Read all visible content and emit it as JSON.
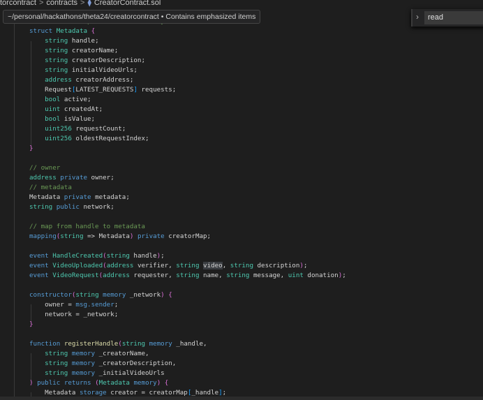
{
  "breadcrumb": {
    "items": [
      "torcontract",
      "contracts",
      "CreatorContract.sol"
    ]
  },
  "tooltip": {
    "text": "~/personal/hackathons/theta24/creatorcontract • Contains emphasized items"
  },
  "find": {
    "value": "read"
  },
  "code": [
    [
      [
        "cm",
        "// struct to represent a data entry"
      ]
    ],
    [
      [
        "kw",
        "struct"
      ],
      [
        "pl",
        " "
      ],
      [
        "ty",
        "Metadata"
      ],
      [
        "pl",
        " "
      ],
      [
        "br",
        "{"
      ]
    ],
    [
      [
        "pl",
        "    "
      ],
      [
        "ty",
        "string"
      ],
      [
        "id",
        " handle;"
      ]
    ],
    [
      [
        "pl",
        "    "
      ],
      [
        "ty",
        "string"
      ],
      [
        "id",
        " creatorName;"
      ]
    ],
    [
      [
        "pl",
        "    "
      ],
      [
        "ty",
        "string"
      ],
      [
        "id",
        " creatorDescription;"
      ]
    ],
    [
      [
        "pl",
        "    "
      ],
      [
        "ty",
        "string"
      ],
      [
        "id",
        " initialVideoUrls;"
      ]
    ],
    [
      [
        "pl",
        "    "
      ],
      [
        "ty",
        "address"
      ],
      [
        "id",
        " creatorAddress;"
      ]
    ],
    [
      [
        "pl",
        "    "
      ],
      [
        "id",
        "Request"
      ],
      [
        "br2",
        "["
      ],
      [
        "id",
        "LATEST_REQUESTS"
      ],
      [
        "br2",
        "]"
      ],
      [
        "id",
        " requests;"
      ]
    ],
    [
      [
        "pl",
        "    "
      ],
      [
        "ty",
        "bool"
      ],
      [
        "id",
        " active;"
      ]
    ],
    [
      [
        "pl",
        "    "
      ],
      [
        "ty",
        "uint"
      ],
      [
        "id",
        " createdAt;"
      ]
    ],
    [
      [
        "pl",
        "    "
      ],
      [
        "ty",
        "bool"
      ],
      [
        "id",
        " isValue;"
      ]
    ],
    [
      [
        "pl",
        "    "
      ],
      [
        "ty",
        "uint256"
      ],
      [
        "id",
        " requestCount;"
      ]
    ],
    [
      [
        "pl",
        "    "
      ],
      [
        "ty",
        "uint256"
      ],
      [
        "id",
        " oldestRequestIndex;"
      ]
    ],
    [
      [
        "br",
        "}"
      ]
    ],
    [],
    [
      [
        "cm",
        "// owner"
      ]
    ],
    [
      [
        "ty",
        "address"
      ],
      [
        "pl",
        " "
      ],
      [
        "kw",
        "private"
      ],
      [
        "id",
        " owner;"
      ]
    ],
    [
      [
        "cm",
        "// metadata"
      ]
    ],
    [
      [
        "id",
        "Metadata "
      ],
      [
        "kw",
        "private"
      ],
      [
        "id",
        " metadata;"
      ]
    ],
    [
      [
        "ty",
        "string"
      ],
      [
        "pl",
        " "
      ],
      [
        "kw",
        "public"
      ],
      [
        "id",
        " network;"
      ]
    ],
    [],
    [
      [
        "cm",
        "// map from handle to metadata"
      ]
    ],
    [
      [
        "kw",
        "mapping"
      ],
      [
        "br",
        "("
      ],
      [
        "ty",
        "string"
      ],
      [
        "id",
        " => Metadata"
      ],
      [
        "br",
        ")"
      ],
      [
        "pl",
        " "
      ],
      [
        "kw",
        "private"
      ],
      [
        "id",
        " creatorMap;"
      ]
    ],
    [],
    [
      [
        "kw",
        "event"
      ],
      [
        "pl",
        " "
      ],
      [
        "ty",
        "HandleCreated"
      ],
      [
        "br",
        "("
      ],
      [
        "ty",
        "string"
      ],
      [
        "id",
        " handle"
      ],
      [
        "br",
        ")"
      ],
      [
        "id",
        ";"
      ]
    ],
    [
      [
        "kw",
        "event"
      ],
      [
        "pl",
        " "
      ],
      [
        "ty",
        "VideoUploaded"
      ],
      [
        "br",
        "("
      ],
      [
        "ty",
        "address"
      ],
      [
        "id",
        " verifier, "
      ],
      [
        "ty",
        "string"
      ],
      [
        "pl",
        " "
      ],
      [
        "hl",
        "video"
      ],
      [
        "id",
        ", "
      ],
      [
        "ty",
        "string"
      ],
      [
        "id",
        " description"
      ],
      [
        "br",
        ")"
      ],
      [
        "id",
        ";"
      ]
    ],
    [
      [
        "kw",
        "event"
      ],
      [
        "pl",
        " "
      ],
      [
        "ty",
        "VideoRequest"
      ],
      [
        "br",
        "("
      ],
      [
        "ty",
        "address"
      ],
      [
        "id",
        " requester, "
      ],
      [
        "ty",
        "string"
      ],
      [
        "id",
        " name, "
      ],
      [
        "ty",
        "string"
      ],
      [
        "id",
        " message, "
      ],
      [
        "ty",
        "uint"
      ],
      [
        "id",
        " donation"
      ],
      [
        "br",
        ")"
      ],
      [
        "id",
        ";"
      ]
    ],
    [],
    [
      [
        "kw",
        "constructor"
      ],
      [
        "br",
        "("
      ],
      [
        "ty",
        "string"
      ],
      [
        "pl",
        " "
      ],
      [
        "kw",
        "memory"
      ],
      [
        "id",
        " _network"
      ],
      [
        "br",
        ")"
      ],
      [
        "pl",
        " "
      ],
      [
        "br",
        "{"
      ]
    ],
    [
      [
        "pl",
        "    "
      ],
      [
        "id",
        "owner = "
      ],
      [
        "kw",
        "msg.sender"
      ],
      [
        "id",
        ";"
      ]
    ],
    [
      [
        "pl",
        "    "
      ],
      [
        "id",
        "network = _network;"
      ]
    ],
    [
      [
        "br",
        "}"
      ]
    ],
    [],
    [
      [
        "kw",
        "function"
      ],
      [
        "pl",
        " "
      ],
      [
        "fn",
        "registerHandle"
      ],
      [
        "br",
        "("
      ],
      [
        "ty",
        "string"
      ],
      [
        "pl",
        " "
      ],
      [
        "kw",
        "memory"
      ],
      [
        "id",
        " _handle,"
      ]
    ],
    [
      [
        "pl",
        "    "
      ],
      [
        "ty",
        "string"
      ],
      [
        "pl",
        " "
      ],
      [
        "kw",
        "memory"
      ],
      [
        "id",
        " _creatorName,"
      ]
    ],
    [
      [
        "pl",
        "    "
      ],
      [
        "ty",
        "string"
      ],
      [
        "pl",
        " "
      ],
      [
        "kw",
        "memory"
      ],
      [
        "id",
        " _creatorDescription,"
      ]
    ],
    [
      [
        "pl",
        "    "
      ],
      [
        "ty",
        "string"
      ],
      [
        "pl",
        " "
      ],
      [
        "kw",
        "memory"
      ],
      [
        "id",
        " _initialVideoUrls"
      ]
    ],
    [
      [
        "br",
        ")"
      ],
      [
        "pl",
        " "
      ],
      [
        "kw",
        "public"
      ],
      [
        "pl",
        " "
      ],
      [
        "kw",
        "returns"
      ],
      [
        "pl",
        " "
      ],
      [
        "br",
        "("
      ],
      [
        "ty",
        "Metadata"
      ],
      [
        "pl",
        " "
      ],
      [
        "kw",
        "memory"
      ],
      [
        "br",
        ")"
      ],
      [
        "pl",
        " "
      ],
      [
        "br",
        "{"
      ]
    ],
    [
      [
        "pl",
        "    "
      ],
      [
        "id",
        "Metadata "
      ],
      [
        "kw",
        "storage"
      ],
      [
        "id",
        " creator = creatorMap"
      ],
      [
        "br2",
        "["
      ],
      [
        "id",
        "_handle"
      ],
      [
        "br2",
        "]"
      ],
      [
        "id",
        ";"
      ]
    ]
  ]
}
